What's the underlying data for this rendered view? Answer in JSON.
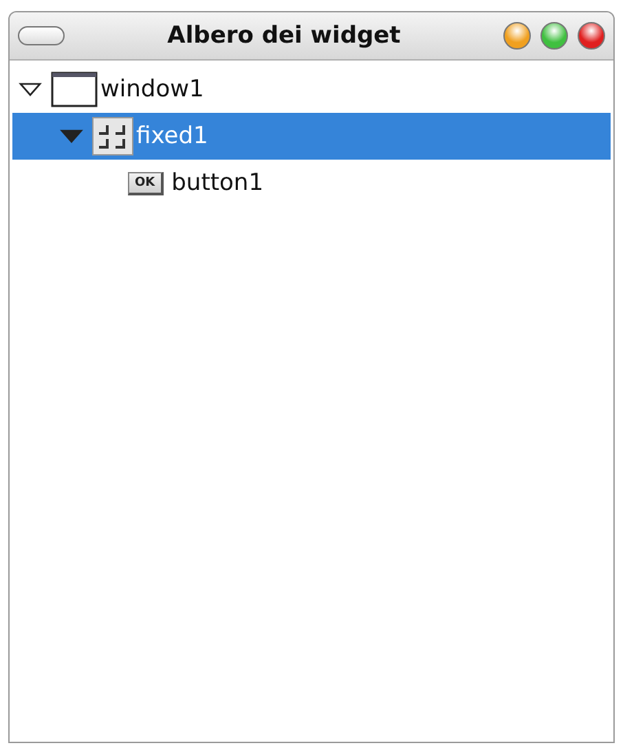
{
  "window": {
    "title": "Albero dei widget"
  },
  "tree": [
    {
      "label": "window1",
      "kind": "window",
      "expanded": true,
      "selected": false,
      "children": [
        {
          "label": "fixed1",
          "kind": "fixed",
          "expanded": true,
          "selected": true,
          "children": [
            {
              "label": "button1",
              "kind": "button",
              "icon_text": "OK",
              "selected": false
            }
          ]
        }
      ]
    }
  ]
}
